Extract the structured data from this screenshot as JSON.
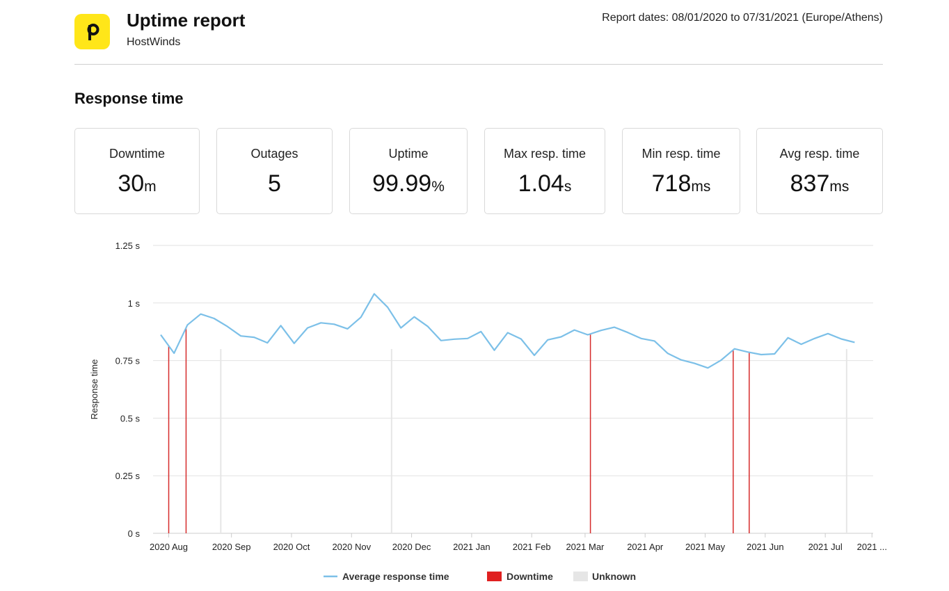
{
  "header": {
    "title": "Uptime report",
    "subtitle": "HostWinds",
    "dates": "Report dates: 08/01/2020 to 07/31/2021 (Europe/Athens)",
    "logo_glyph": "p",
    "logo_color": "#ffe619"
  },
  "section_title": "Response time",
  "stats": [
    {
      "label": "Downtime",
      "value": "30",
      "unit": "m"
    },
    {
      "label": "Outages",
      "value": "5",
      "unit": ""
    },
    {
      "label": "Uptime",
      "value": "99.99",
      "unit": "%"
    },
    {
      "label": "Max resp. time",
      "value": "1.04",
      "unit": "s"
    },
    {
      "label": "Min resp. time",
      "value": "718",
      "unit": "ms"
    },
    {
      "label": "Avg resp. time",
      "value": "837",
      "unit": "ms"
    }
  ],
  "chart_data": {
    "type": "line",
    "ylabel": "Response time",
    "xlabel": "",
    "ylim": [
      0,
      1.25
    ],
    "y_ticks": [
      {
        "value": 0,
        "label": "0  s"
      },
      {
        "value": 0.25,
        "label": "0.25  s"
      },
      {
        "value": 0.5,
        "label": "0.5  s"
      },
      {
        "value": 0.75,
        "label": "0.75  s"
      },
      {
        "value": 1,
        "label": "1  s"
      },
      {
        "value": 1.25,
        "label": "1.25  s"
      }
    ],
    "x_ticks": [
      {
        "week": 0.6,
        "label": "2020 Aug"
      },
      {
        "week": 5.3,
        "label": "2020 Sep"
      },
      {
        "week": 9.8,
        "label": "2020 Oct"
      },
      {
        "week": 14.3,
        "label": "2020 Nov"
      },
      {
        "week": 18.8,
        "label": "2020 Dec"
      },
      {
        "week": 23.3,
        "label": "2021 Jan"
      },
      {
        "week": 27.8,
        "label": "2021 Feb"
      },
      {
        "week": 31.8,
        "label": "2021 Mar"
      },
      {
        "week": 36.3,
        "label": "2021 Apr"
      },
      {
        "week": 40.8,
        "label": "2021 May"
      },
      {
        "week": 45.3,
        "label": "2021 Jun"
      },
      {
        "week": 49.8,
        "label": "2021 Jul"
      },
      {
        "week": 53.3,
        "label": "2021 ..."
      }
    ],
    "x_range": [
      0,
      54
    ],
    "series": [
      {
        "name": "Average response time",
        "color": "#7cc0e8",
        "x_unit": "week",
        "points": [
          [
            0,
            0.862
          ],
          [
            1,
            0.782
          ],
          [
            2,
            0.905
          ],
          [
            3,
            0.952
          ],
          [
            4,
            0.933
          ],
          [
            5,
            0.898
          ],
          [
            6,
            0.857
          ],
          [
            7,
            0.851
          ],
          [
            8,
            0.827
          ],
          [
            9,
            0.902
          ],
          [
            10,
            0.825
          ],
          [
            11,
            0.892
          ],
          [
            12,
            0.914
          ],
          [
            13,
            0.908
          ],
          [
            14,
            0.888
          ],
          [
            15,
            0.938
          ],
          [
            16,
            1.04
          ],
          [
            17,
            0.982
          ],
          [
            18,
            0.892
          ],
          [
            19,
            0.94
          ],
          [
            20,
            0.899
          ],
          [
            21,
            0.837
          ],
          [
            22,
            0.843
          ],
          [
            23,
            0.846
          ],
          [
            24,
            0.876
          ],
          [
            25,
            0.795
          ],
          [
            26,
            0.871
          ],
          [
            27,
            0.844
          ],
          [
            28,
            0.773
          ],
          [
            29,
            0.84
          ],
          [
            30,
            0.853
          ],
          [
            31,
            0.883
          ],
          [
            32,
            0.862
          ],
          [
            33,
            0.881
          ],
          [
            34,
            0.895
          ],
          [
            35,
            0.872
          ],
          [
            36,
            0.846
          ],
          [
            37,
            0.835
          ],
          [
            38,
            0.781
          ],
          [
            39,
            0.753
          ],
          [
            40,
            0.738
          ],
          [
            41,
            0.718
          ],
          [
            42,
            0.752
          ],
          [
            43,
            0.801
          ],
          [
            44,
            0.787
          ],
          [
            45,
            0.776
          ],
          [
            46,
            0.779
          ],
          [
            47,
            0.849
          ],
          [
            48,
            0.821
          ],
          [
            49,
            0.846
          ],
          [
            50,
            0.867
          ],
          [
            51,
            0.844
          ],
          [
            52,
            0.829
          ]
        ]
      }
    ],
    "downtime_weeks": [
      0.6,
      1.9,
      32.2,
      42.9,
      44.1
    ],
    "unknown_weeks": [
      4.5,
      17.3,
      51.4
    ],
    "legend": {
      "position": "bottom",
      "items": [
        {
          "label": "Average response time",
          "kind": "line",
          "color": "#7cc0e8"
        },
        {
          "label": "Downtime",
          "kind": "box",
          "color": "#e02020"
        },
        {
          "label": "Unknown",
          "kind": "box",
          "color": "#e6e6e6"
        }
      ]
    },
    "grid": true
  }
}
